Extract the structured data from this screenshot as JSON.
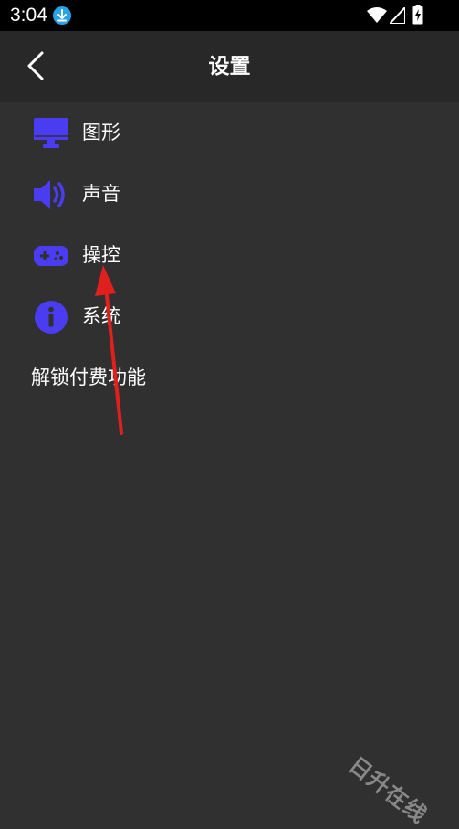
{
  "status_bar": {
    "time": "3:04",
    "icons": [
      "download-icon",
      "wifi-icon",
      "signal-icon",
      "battery-charging-icon"
    ]
  },
  "header": {
    "title": "设置",
    "back_icon": "chevron-left-icon"
  },
  "menu": {
    "items": [
      {
        "label": "图形",
        "icon": "monitor-icon"
      },
      {
        "label": "声音",
        "icon": "speaker-icon"
      },
      {
        "label": "操控",
        "icon": "gamepad-icon"
      },
      {
        "label": "系统",
        "icon": "info-icon"
      },
      {
        "label": "解锁付费功能",
        "icon": ""
      }
    ]
  },
  "watermark": {
    "text": "日升在线"
  },
  "colors": {
    "background": "#303030",
    "app_bar": "#282828",
    "status_bar": "#000000",
    "icon_accent": "#4a3cf0",
    "annotation_arrow": "#e0201c",
    "download_badge": "#29a3e8"
  }
}
